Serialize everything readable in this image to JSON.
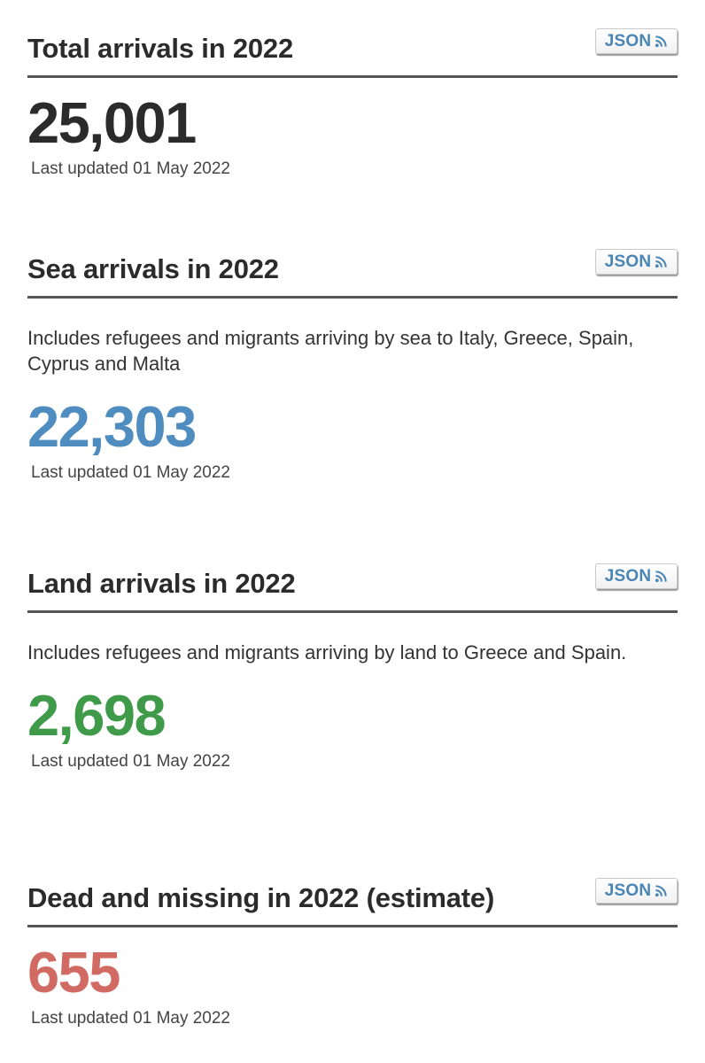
{
  "colors": {
    "total": "#2b2b2b",
    "sea": "#4f8cbf",
    "land": "#3f9a4a",
    "dead": "#d06a63",
    "json_text": "#4a86b5"
  },
  "icons": {
    "json_feed": "rss-icon"
  },
  "sections": [
    {
      "title": "Total arrivals in 2022",
      "json_label": "JSON",
      "description": "",
      "value": "25,001",
      "updated": "Last updated 01 May 2022"
    },
    {
      "title": "Sea arrivals in 2022",
      "json_label": "JSON",
      "description": "Includes refugees and migrants arriving by sea to Italy, Greece, Spain, Cyprus and Malta",
      "value": "22,303",
      "updated": "Last updated 01 May 2022"
    },
    {
      "title": "Land arrivals in 2022",
      "json_label": "JSON",
      "description": "Includes refugees and migrants arriving by land to Greece and Spain.",
      "value": "2,698",
      "updated": "Last updated 01 May 2022"
    },
    {
      "title": "Dead and missing in 2022 (estimate)",
      "json_label": "JSON",
      "description": "",
      "value": "655",
      "updated": "Last updated 01 May 2022"
    }
  ]
}
